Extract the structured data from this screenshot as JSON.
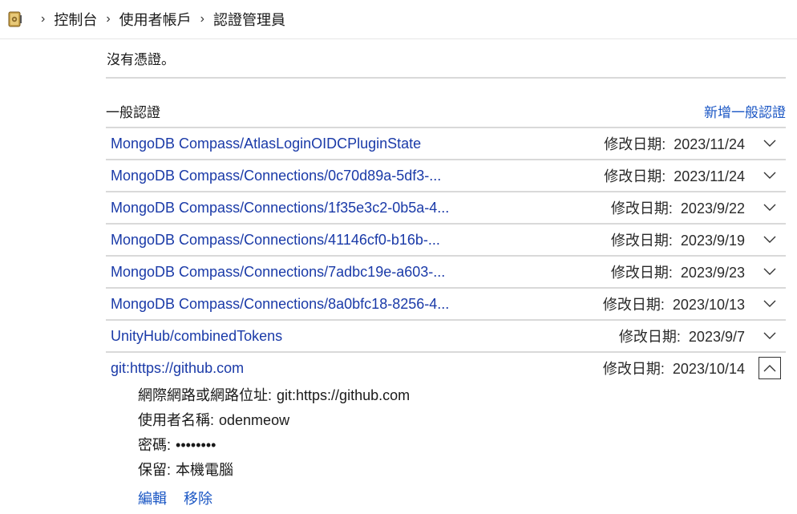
{
  "breadcrumb": {
    "icon": "credential-vault-icon",
    "items": [
      "控制台",
      "使用者帳戶",
      "認證管理員"
    ]
  },
  "status": {
    "no_credentials": "沒有憑證。"
  },
  "section": {
    "title": "一般認證",
    "add_link": "新增一般認證"
  },
  "date_label": "修改日期:",
  "credentials": [
    {
      "name": "MongoDB Compass/AtlasLoginOIDCPluginState",
      "date": "2023/11/24"
    },
    {
      "name": "MongoDB Compass/Connections/0c70d89a-5df3-...",
      "date": "2023/11/24"
    },
    {
      "name": "MongoDB Compass/Connections/1f35e3c2-0b5a-4...",
      "date": "2023/9/22"
    },
    {
      "name": "MongoDB Compass/Connections/41146cf0-b16b-...",
      "date": "2023/9/19"
    },
    {
      "name": "MongoDB Compass/Connections/7adbc19e-a603-...",
      "date": "2023/9/23"
    },
    {
      "name": "MongoDB Compass/Connections/8a0bfc18-8256-4...",
      "date": "2023/10/13"
    },
    {
      "name": "UnityHub/combinedTokens",
      "date": "2023/9/7"
    },
    {
      "name": "git:https://github.com",
      "date": "2023/10/14"
    }
  ],
  "expanded": {
    "address_label": "網際網路或網路位址:",
    "address_value": "git:https://github.com",
    "user_label": "使用者名稱:",
    "user_value": "odenmeow",
    "password_label": "密碼:",
    "password_value": "••••••••",
    "persist_label": "保留:",
    "persist_value": "本機電腦",
    "edit_link": "編輯",
    "remove_link": "移除"
  }
}
